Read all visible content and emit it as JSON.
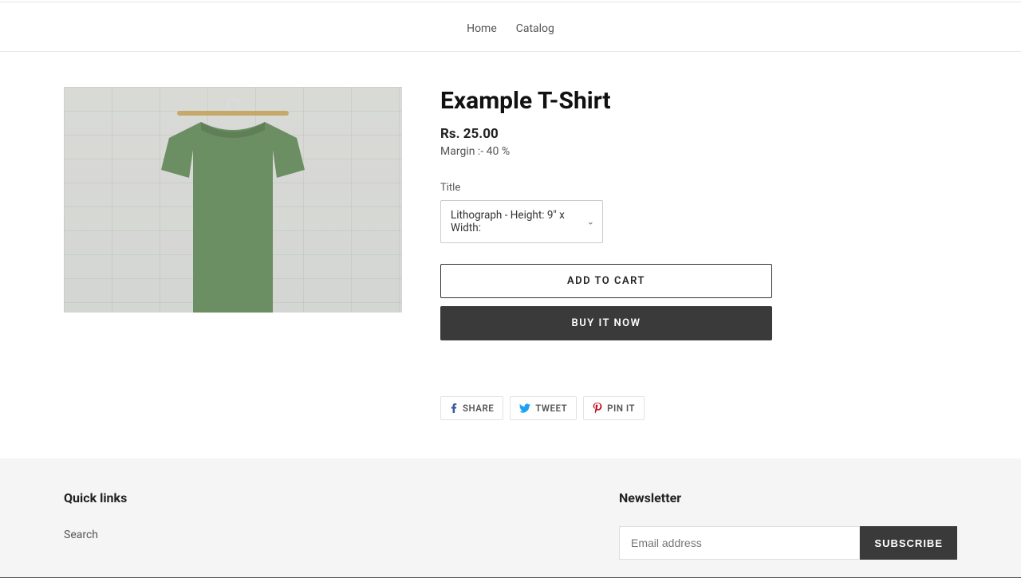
{
  "header": {
    "nav": {
      "home": "Home",
      "catalog": "Catalog"
    }
  },
  "product": {
    "title": "Example T-Shirt",
    "price": "Rs. 25.00",
    "margin": "Margin :- 40 %",
    "variant_label": "Title",
    "variant_selected": "Lithograph - Height: 9\" x Width:",
    "add_to_cart": "ADD TO CART",
    "buy_now": "BUY IT NOW"
  },
  "social": {
    "share": "SHARE",
    "tweet": "TWEET",
    "pin": "PIN IT"
  },
  "footer": {
    "quick_links_title": "Quick links",
    "search": "Search",
    "newsletter_title": "Newsletter",
    "email_placeholder": "Email address",
    "subscribe": "SUBSCRIBE"
  }
}
